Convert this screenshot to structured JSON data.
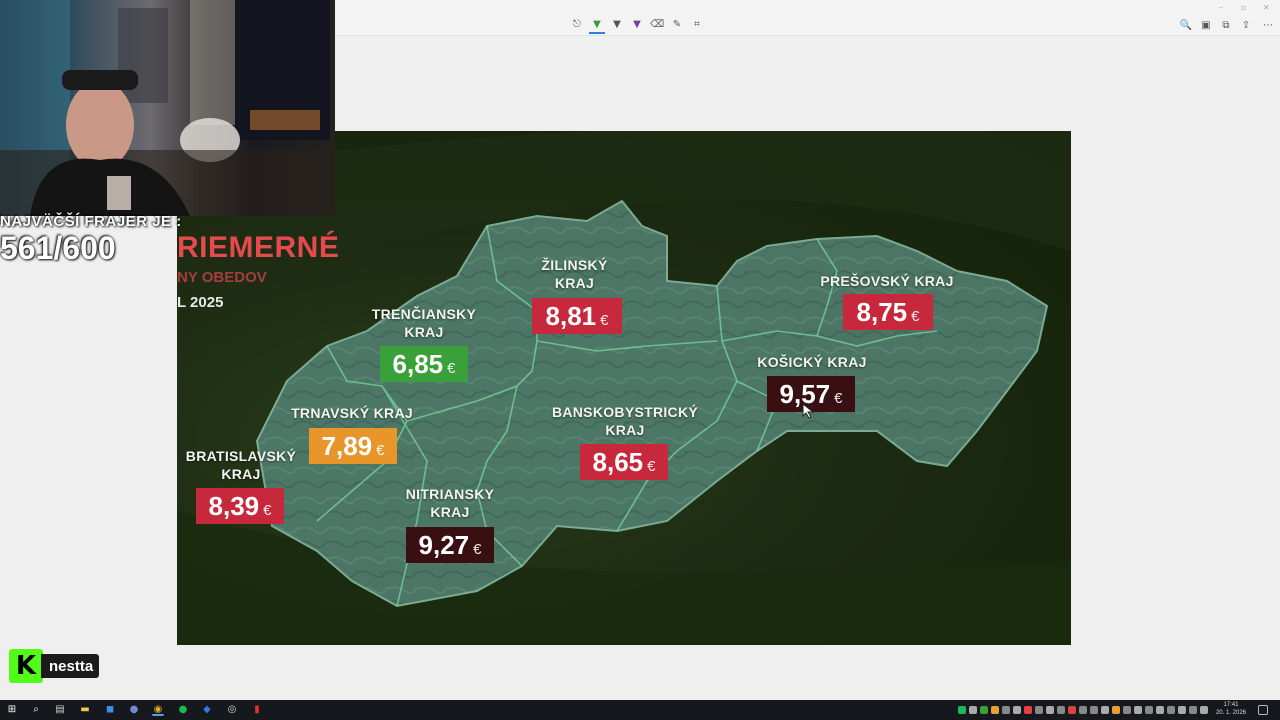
{
  "viewer": {
    "tools": [
      {
        "icon": "select-icon",
        "glyph": "⎋"
      },
      {
        "icon": "highlighter-green-icon",
        "glyph": "▼"
      },
      {
        "icon": "pen-icon",
        "glyph": "▼"
      },
      {
        "icon": "highlighter-purple-icon",
        "glyph": "▼"
      },
      {
        "icon": "eraser-icon",
        "glyph": "⌫"
      },
      {
        "icon": "pencil-icon",
        "glyph": "✎"
      },
      {
        "icon": "crop-icon",
        "glyph": "⌗"
      }
    ],
    "right_tools": [
      {
        "icon": "zoom-icon",
        "glyph": "🔍"
      },
      {
        "icon": "save-icon",
        "glyph": "▣"
      },
      {
        "icon": "copy-icon",
        "glyph": "⧉"
      },
      {
        "icon": "share-icon",
        "glyph": "⇪"
      },
      {
        "icon": "more-icon",
        "glyph": "⋯"
      }
    ],
    "window_controls": [
      "–",
      "▫",
      "✕"
    ]
  },
  "image": {
    "headline": "RIEMERNÉ",
    "subheadline": "NY OBEDOV",
    "year": "L 2025",
    "regions": [
      {
        "label": "ŽILINSKÝ\nKRAJ",
        "price": "8,81",
        "color": "#c8283c"
      },
      {
        "label": "PREŠOVSKÝ KRAJ",
        "price": "8,75",
        "color": "#c8283c"
      },
      {
        "label": "TRENČIANSKY\nKRAJ",
        "price": "6,85",
        "color": "#3aa03a"
      },
      {
        "label": "KOŠICKÝ KRAJ",
        "price": "9,57",
        "color": "#3a0f12"
      },
      {
        "label": "TRNAVSKÝ KRAJ",
        "price": "7,89",
        "color": "#e8962a"
      },
      {
        "label": "BANSKOBYSTRICKÝ\nKRAJ",
        "price": "8,65",
        "color": "#c8283c"
      },
      {
        "label": "BRATISLAVSKÝ\nKRAJ",
        "price": "8,39",
        "color": "#c8283c"
      },
      {
        "label": "NITRIANSKY\nKRAJ",
        "price": "9,27",
        "color": "#3a0f12"
      }
    ],
    "currency": "€"
  },
  "overlay": {
    "streak_label": "NAJVÄČŠÍ FRAJER JE :",
    "streak_count": "561/600",
    "kick_logo": "K",
    "kick_name": "nestta"
  },
  "taskbar": {
    "apps": [
      {
        "icon": "windows-start-icon",
        "glyph": "⊞",
        "color": "#ffffff"
      },
      {
        "icon": "search-icon",
        "glyph": "⌕",
        "color": "#ffffff"
      },
      {
        "icon": "task-view-icon",
        "glyph": "▤",
        "color": "#cccccc"
      },
      {
        "icon": "file-explorer-icon",
        "glyph": "▬",
        "color": "#f2c94c"
      },
      {
        "icon": "store-icon",
        "glyph": "◼",
        "color": "#3b8fe8"
      },
      {
        "icon": "discord-icon",
        "glyph": "●",
        "color": "#7289da"
      },
      {
        "icon": "chrome-icon",
        "glyph": "◉",
        "color": "#e0b020"
      },
      {
        "icon": "spotify-icon",
        "glyph": "●",
        "color": "#1db954"
      },
      {
        "icon": "app-blue-icon",
        "glyph": "◆",
        "color": "#2d7be0"
      },
      {
        "icon": "obs-icon",
        "glyph": "◎",
        "color": "#dddddd"
      },
      {
        "icon": "app-red-icon",
        "glyph": "▮",
        "color": "#e03030"
      }
    ],
    "time": "17:41",
    "date": "20. 1. 2026"
  }
}
